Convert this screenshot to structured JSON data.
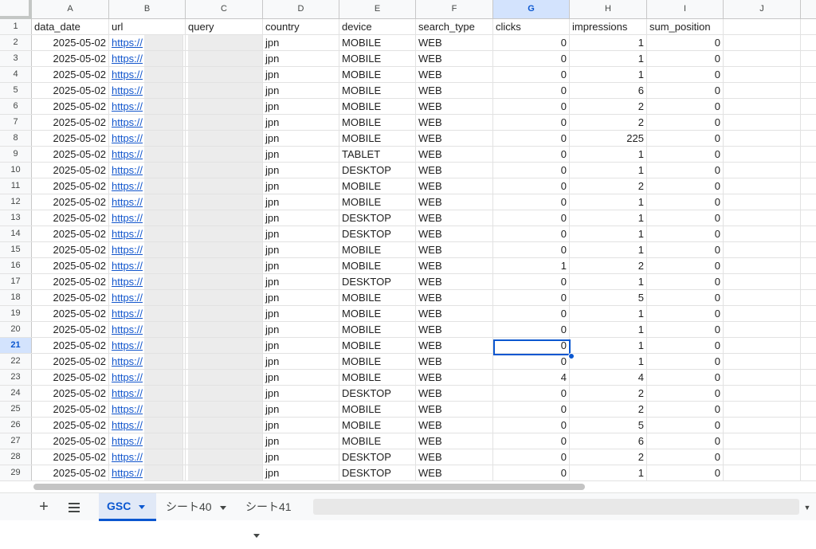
{
  "column_headers": [
    "A",
    "B",
    "C",
    "D",
    "E",
    "F",
    "G",
    "H",
    "I",
    "J"
  ],
  "selected_column": "G",
  "selected_row": 21,
  "header_row_number": 1,
  "field_names": [
    "data_date",
    "url",
    "query",
    "country",
    "device",
    "search_type",
    "clicks",
    "impressions",
    "sum_position"
  ],
  "rows": [
    {
      "n": 2,
      "data_date": "2025-05-02",
      "url": "https://",
      "country": "jpn",
      "device": "MOBILE",
      "search_type": "WEB",
      "clicks": 0,
      "impressions": 1,
      "sum_position": 0
    },
    {
      "n": 3,
      "data_date": "2025-05-02",
      "url": "https://",
      "country": "jpn",
      "device": "MOBILE",
      "search_type": "WEB",
      "clicks": 0,
      "impressions": 1,
      "sum_position": 0
    },
    {
      "n": 4,
      "data_date": "2025-05-02",
      "url": "https://",
      "country": "jpn",
      "device": "MOBILE",
      "search_type": "WEB",
      "clicks": 0,
      "impressions": 1,
      "sum_position": 0
    },
    {
      "n": 5,
      "data_date": "2025-05-02",
      "url": "https://",
      "country": "jpn",
      "device": "MOBILE",
      "search_type": "WEB",
      "clicks": 0,
      "impressions": 6,
      "sum_position": 0
    },
    {
      "n": 6,
      "data_date": "2025-05-02",
      "url": "https://",
      "country": "jpn",
      "device": "MOBILE",
      "search_type": "WEB",
      "clicks": 0,
      "impressions": 2,
      "sum_position": 0
    },
    {
      "n": 7,
      "data_date": "2025-05-02",
      "url": "https://",
      "country": "jpn",
      "device": "MOBILE",
      "search_type": "WEB",
      "clicks": 0,
      "impressions": 2,
      "sum_position": 0
    },
    {
      "n": 8,
      "data_date": "2025-05-02",
      "url": "https://",
      "country": "jpn",
      "device": "MOBILE",
      "search_type": "WEB",
      "clicks": 0,
      "impressions": 225,
      "sum_position": 0
    },
    {
      "n": 9,
      "data_date": "2025-05-02",
      "url": "https://",
      "country": "jpn",
      "device": "TABLET",
      "search_type": "WEB",
      "clicks": 0,
      "impressions": 1,
      "sum_position": 0
    },
    {
      "n": 10,
      "data_date": "2025-05-02",
      "url": "https://",
      "country": "jpn",
      "device": "DESKTOP",
      "search_type": "WEB",
      "clicks": 0,
      "impressions": 1,
      "sum_position": 0
    },
    {
      "n": 11,
      "data_date": "2025-05-02",
      "url": "https://",
      "country": "jpn",
      "device": "MOBILE",
      "search_type": "WEB",
      "clicks": 0,
      "impressions": 2,
      "sum_position": 0
    },
    {
      "n": 12,
      "data_date": "2025-05-02",
      "url": "https://",
      "country": "jpn",
      "device": "MOBILE",
      "search_type": "WEB",
      "clicks": 0,
      "impressions": 1,
      "sum_position": 0
    },
    {
      "n": 13,
      "data_date": "2025-05-02",
      "url": "https://",
      "country": "jpn",
      "device": "DESKTOP",
      "search_type": "WEB",
      "clicks": 0,
      "impressions": 1,
      "sum_position": 0
    },
    {
      "n": 14,
      "data_date": "2025-05-02",
      "url": "https://",
      "country": "jpn",
      "device": "DESKTOP",
      "search_type": "WEB",
      "clicks": 0,
      "impressions": 1,
      "sum_position": 0
    },
    {
      "n": 15,
      "data_date": "2025-05-02",
      "url": "https://",
      "country": "jpn",
      "device": "MOBILE",
      "search_type": "WEB",
      "clicks": 0,
      "impressions": 1,
      "sum_position": 0
    },
    {
      "n": 16,
      "data_date": "2025-05-02",
      "url": "https://",
      "country": "jpn",
      "device": "MOBILE",
      "search_type": "WEB",
      "clicks": 1,
      "impressions": 2,
      "sum_position": 0
    },
    {
      "n": 17,
      "data_date": "2025-05-02",
      "url": "https://",
      "country": "jpn",
      "device": "DESKTOP",
      "search_type": "WEB",
      "clicks": 0,
      "impressions": 1,
      "sum_position": 0
    },
    {
      "n": 18,
      "data_date": "2025-05-02",
      "url": "https://",
      "country": "jpn",
      "device": "MOBILE",
      "search_type": "WEB",
      "clicks": 0,
      "impressions": 5,
      "sum_position": 0
    },
    {
      "n": 19,
      "data_date": "2025-05-02",
      "url": "https://",
      "country": "jpn",
      "device": "MOBILE",
      "search_type": "WEB",
      "clicks": 0,
      "impressions": 1,
      "sum_position": 0
    },
    {
      "n": 20,
      "data_date": "2025-05-02",
      "url": "https://",
      "country": "jpn",
      "device": "MOBILE",
      "search_type": "WEB",
      "clicks": 0,
      "impressions": 1,
      "sum_position": 0
    },
    {
      "n": 21,
      "data_date": "2025-05-02",
      "url": "https://",
      "country": "jpn",
      "device": "MOBILE",
      "search_type": "WEB",
      "clicks": 0,
      "impressions": 1,
      "sum_position": 0
    },
    {
      "n": 22,
      "data_date": "2025-05-02",
      "url": "https://",
      "country": "jpn",
      "device": "MOBILE",
      "search_type": "WEB",
      "clicks": 0,
      "impressions": 1,
      "sum_position": 0
    },
    {
      "n": 23,
      "data_date": "2025-05-02",
      "url": "https://",
      "country": "jpn",
      "device": "MOBILE",
      "search_type": "WEB",
      "clicks": 4,
      "impressions": 4,
      "sum_position": 0
    },
    {
      "n": 24,
      "data_date": "2025-05-02",
      "url": "https://",
      "country": "jpn",
      "device": "DESKTOP",
      "search_type": "WEB",
      "clicks": 0,
      "impressions": 2,
      "sum_position": 0
    },
    {
      "n": 25,
      "data_date": "2025-05-02",
      "url": "https://",
      "country": "jpn",
      "device": "MOBILE",
      "search_type": "WEB",
      "clicks": 0,
      "impressions": 2,
      "sum_position": 0
    },
    {
      "n": 26,
      "data_date": "2025-05-02",
      "url": "https://",
      "country": "jpn",
      "device": "MOBILE",
      "search_type": "WEB",
      "clicks": 0,
      "impressions": 5,
      "sum_position": 0
    },
    {
      "n": 27,
      "data_date": "2025-05-02",
      "url": "https://",
      "country": "jpn",
      "device": "MOBILE",
      "search_type": "WEB",
      "clicks": 0,
      "impressions": 6,
      "sum_position": 0
    },
    {
      "n": 28,
      "data_date": "2025-05-02",
      "url": "https://",
      "country": "jpn",
      "device": "DESKTOP",
      "search_type": "WEB",
      "clicks": 0,
      "impressions": 2,
      "sum_position": 0
    },
    {
      "n": 29,
      "data_date": "2025-05-02",
      "url": "https://",
      "country": "jpn",
      "device": "DESKTOP",
      "search_type": "WEB",
      "clicks": 0,
      "impressions": 1,
      "sum_position": 0
    }
  ],
  "tabs": {
    "add_icon": "plus-icon",
    "menu_icon": "list-menu-icon",
    "sheets": [
      {
        "label": "GSC",
        "active": true
      },
      {
        "label": "シート40",
        "active": false
      },
      {
        "label": "シート41",
        "active": false
      }
    ]
  },
  "colors": {
    "accent": "#0b57d0",
    "link": "#1155cc",
    "selected_header_bg": "#d3e3fd",
    "masked_cell": "#ececec"
  }
}
